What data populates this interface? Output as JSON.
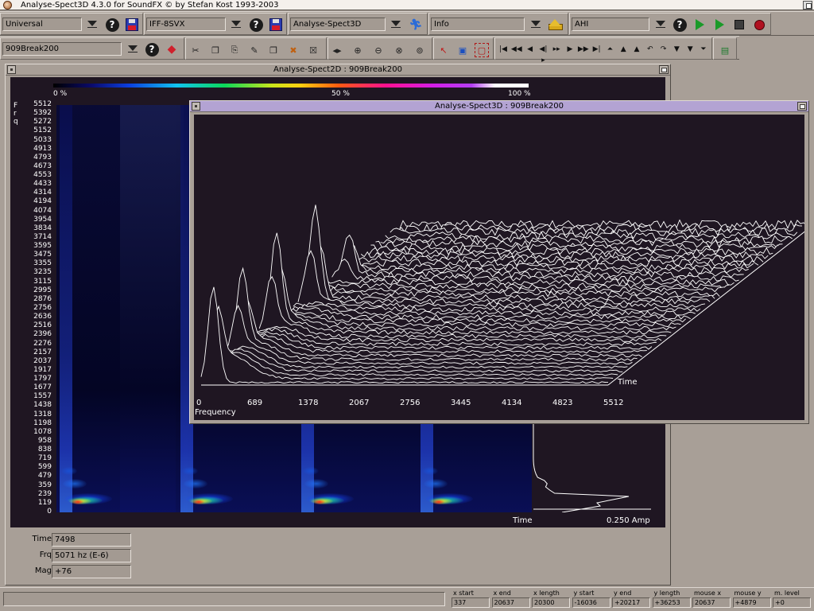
{
  "window": {
    "title": "Analyse-Spect3D 4.3.0 for SoundFX © by Stefan Kost 1993-2003"
  },
  "toolbar": {
    "source_select": "Universal",
    "loader_select": "IFF-8SVX",
    "operator_select": "Analyse-Spect3D",
    "info_select": "Info",
    "player_select": "AHI",
    "buffer_select": "909Break200"
  },
  "transport_glyphs": [
    "|◀",
    "◀◀",
    "◀",
    "◀|▸",
    "▸▸",
    "▶",
    "▶▶",
    "▶|",
    "⏶",
    "▲",
    "▲",
    "↶",
    "↷",
    "▼",
    "▼",
    "⏷"
  ],
  "spect2d": {
    "title": "Analyse-Spect2D : 909Break200",
    "colorbar_labels": [
      "0 %",
      "50 %",
      "100 %"
    ],
    "freq_axis_letters": [
      "F",
      "r",
      "q"
    ],
    "freq_ticks": [
      "5512",
      "5392",
      "5272",
      "5152",
      "5033",
      "4913",
      "4793",
      "4673",
      "4553",
      "4433",
      "4314",
      "4194",
      "4074",
      "3954",
      "3834",
      "3714",
      "3595",
      "3475",
      "3355",
      "3235",
      "3115",
      "2995",
      "2876",
      "2756",
      "2636",
      "2516",
      "2396",
      "2276",
      "2157",
      "2037",
      "1917",
      "1797",
      "1677",
      "1557",
      "1438",
      "1318",
      "1198",
      "1078",
      "958",
      "838",
      "719",
      "599",
      "479",
      "359",
      "239",
      "119",
      "0"
    ],
    "x_axis_label": "Time",
    "amp_label": "0.250 Amp",
    "info": {
      "time_label": "Time",
      "time_value": "7498",
      "frq_label": "Frq",
      "frq_value": "5071 hz (E-6)",
      "mag_label": "Mag",
      "mag_value": "+76"
    }
  },
  "spect3d": {
    "title": "Analyse-Spect3D : 909Break200",
    "freq_ticks": [
      "0",
      "689",
      "1378",
      "2067",
      "2756",
      "3445",
      "4134",
      "4823",
      "5512"
    ],
    "x_label": "Frequency",
    "depth_label": "Time"
  },
  "status": {
    "message": "",
    "columns": [
      {
        "label": "x start",
        "value": "337"
      },
      {
        "label": "x end",
        "value": "20637"
      },
      {
        "label": "x length",
        "value": "20300"
      },
      {
        "label": "y start",
        "value": "-16036"
      },
      {
        "label": "y end",
        "value": "+20217"
      },
      {
        "label": "y length",
        "value": "+36253"
      },
      {
        "label": "mouse x",
        "value": "20637"
      },
      {
        "label": "mouse y",
        "value": "+4879"
      },
      {
        "label": "m. level",
        "value": "+0"
      }
    ]
  },
  "colors": {
    "plot_background": "#1f1622",
    "active_title": "#b3a3d3",
    "play_green": "#1a9a29",
    "record_red": "#b01020"
  }
}
